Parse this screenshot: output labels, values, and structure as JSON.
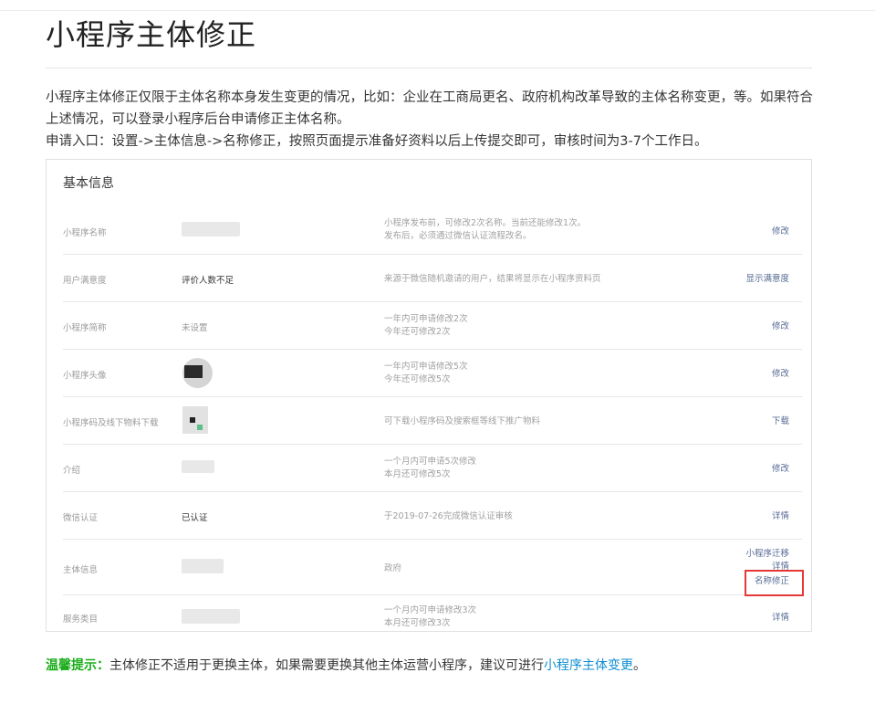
{
  "page": {
    "title": "小程序主体修正",
    "intro": [
      "小程序主体修正仅限于主体名称本身发生变更的情况，比如：企业在工商局更名、政府机构改革导致的主体名称变更，等。如果符合上述情况，可以登录小程序后台申请修正主体名称。",
      "申请入口：设置->主体信息->名称修正，按照页面提示准备好资料以后上传提交即可，审核时间为3-7个工作日。"
    ]
  },
  "panel": {
    "heading": "基本信息",
    "rows": [
      {
        "label": "小程序名称",
        "value": "",
        "desc": [
          "小程序发布前，可修改2次名称。当前还能修改1次。",
          "发布后，必须通过微信认证流程改名。"
        ],
        "actions": [
          "修改"
        ]
      },
      {
        "label": "用户满意度",
        "value": "评价人数不足",
        "desc": [
          "来源于微信随机邀请的用户，结果将显示在小程序资料页"
        ],
        "actions": [
          "显示满意度"
        ]
      },
      {
        "label": "小程序简称",
        "value": "未设置",
        "desc": [
          "一年内可申请修改2次",
          "今年还可修改2次"
        ],
        "actions": [
          "修改"
        ]
      },
      {
        "label": "小程序头像",
        "value": "",
        "desc": [
          "一年内可申请修改5次",
          "今年还可修改5次"
        ],
        "actions": [
          "修改"
        ]
      },
      {
        "label": "小程序码及线下物料下载",
        "value": "",
        "desc": [
          "可下载小程序码及搜索框等线下推广物料"
        ],
        "actions": [
          "下载"
        ]
      },
      {
        "label": "介绍",
        "value": "",
        "desc": [
          "一个月内可申请5次修改",
          "本月还可修改5次"
        ],
        "actions": [
          "修改"
        ]
      },
      {
        "label": "微信认证",
        "value": "已认证",
        "desc": [
          "于2019-07-26完成微信认证审核"
        ],
        "actions": [
          "详情"
        ]
      },
      {
        "label": "主体信息",
        "value": "",
        "desc": [
          "政府"
        ],
        "actions": [
          "小程序迁移",
          "详情",
          "名称修正"
        ]
      },
      {
        "label": "服务类目",
        "value": "",
        "desc": [
          "一个月内可申请修改3次",
          "本月还可修改3次"
        ],
        "actions": [
          "详情"
        ]
      }
    ]
  },
  "tip": {
    "lead": "温馨提示：",
    "text": "主体修正不适用于更换主体，如果需要更换其他主体运营小程序，建议可进行",
    "link": "小程序主体变更",
    "end": "。"
  },
  "colors": {
    "link": "#576b95",
    "tip_lead": "#1aad19",
    "tip_link": "#0e8fd3",
    "highlight": "#e53935"
  }
}
